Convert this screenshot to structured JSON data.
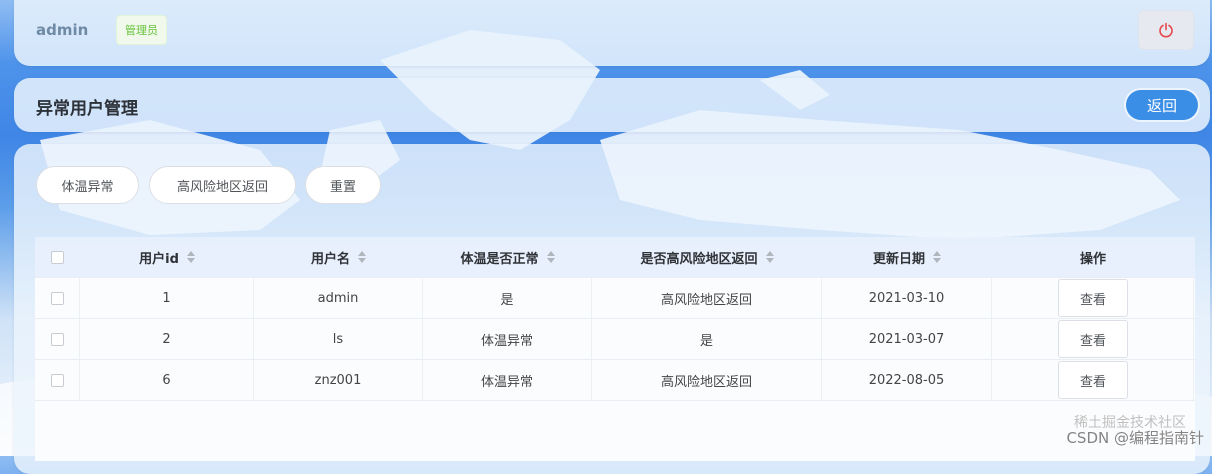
{
  "header": {
    "username": "admin",
    "role_tag": "管理员",
    "power_icon": "power-icon",
    "power_color": "#e5484d"
  },
  "page": {
    "title": "异常用户管理",
    "back_label": "返回"
  },
  "filters": [
    {
      "label": "体温异常"
    },
    {
      "label": "高风险地区返回"
    },
    {
      "label": "重置"
    }
  ],
  "table": {
    "columns": [
      "用户id",
      "用户名",
      "体温是否正常",
      "是否高风险地区返回",
      "更新日期",
      "操作"
    ],
    "rows": [
      {
        "id": "1",
        "name": "admin",
        "temp": "是",
        "risk": "高风险地区返回",
        "date": "2021-03-10",
        "action": "查看"
      },
      {
        "id": "2",
        "name": "ls",
        "temp": "体温异常",
        "risk": "是",
        "date": "2021-03-07",
        "action": "查看"
      },
      {
        "id": "6",
        "name": "znz001",
        "temp": "体温异常",
        "risk": "高风险地区返回",
        "date": "2022-08-05",
        "action": "查看"
      }
    ]
  },
  "theme": {
    "accent": "#3a8ee6",
    "tag_green": "#67c23a"
  },
  "watermark": "CSDN @编程指南针",
  "watermark_overlay": "稀土掘金技术社区"
}
